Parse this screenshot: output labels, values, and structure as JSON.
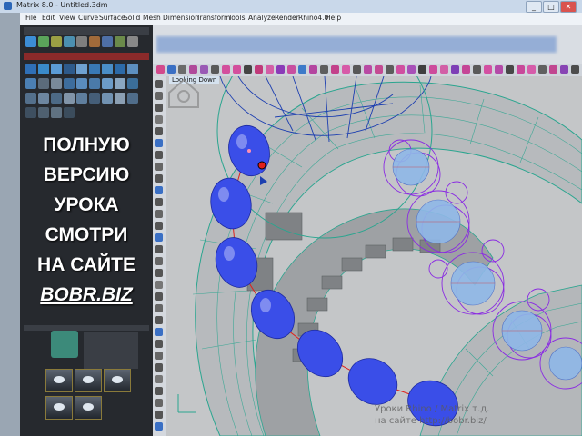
{
  "window": {
    "title": "Matrix 8.0 - Untitled.3dm",
    "minimize_label": "_",
    "maximize_label": "□",
    "close_label": "✕"
  },
  "menu": {
    "items": [
      "File",
      "Edit",
      "View",
      "Curve",
      "Surface",
      "Solid",
      "Mesh",
      "Dimension",
      "Transform",
      "Tools",
      "Analyze",
      "Render",
      "Rhino4.0",
      "Help"
    ]
  },
  "viewport": {
    "label": "Looking Down"
  },
  "promo": {
    "lines": [
      "ПОЛНУЮ",
      "ВЕРСИЮ",
      "УРОКА",
      "СМОТРИ",
      "НА САЙТЕ"
    ],
    "site": "BOBR.BIZ"
  },
  "watermark": {
    "line1": "Уроки Rhino / Matrix т.д.",
    "line2": "на сайте http://bobr.biz/"
  },
  "colors": {
    "gem_fill": "#3a4ee8",
    "ring_wire": "#2aa58f",
    "prong_wire": "#8a2be2",
    "selected_wire": "#1d3fb0",
    "accent_red": "#e0201c"
  },
  "icons": {
    "toolbar": [
      "open-icon",
      "save-icon",
      "print-icon",
      "cut-icon",
      "copy-icon",
      "paste-icon",
      "undo-icon",
      "redo-icon",
      "pan-icon",
      "rotate-icon",
      "zoom-icon",
      "zoom-window-icon",
      "zoom-extents-icon",
      "select-icon",
      "grid-icon",
      "layer-icon",
      "render-icon",
      "material-icon",
      "light-icon",
      "gem-icon",
      "help-icon"
    ],
    "side": [
      "point-icon",
      "line-icon",
      "polyline-icon",
      "curve-icon",
      "circle-icon",
      "arc-icon",
      "ellipse-icon",
      "rectangle-icon",
      "polygon-icon",
      "text-icon",
      "surface-icon",
      "box-icon",
      "sphere-icon",
      "cylinder-icon",
      "extrude-icon",
      "boolean-icon",
      "fillet-icon",
      "move-icon",
      "copy-obj-icon",
      "rotate-obj-icon",
      "scale-icon",
      "mirror-icon",
      "array-icon",
      "trim-icon",
      "split-icon",
      "join-icon",
      "explode-icon",
      "group-icon",
      "dimension-icon",
      "analyze-icon"
    ]
  }
}
